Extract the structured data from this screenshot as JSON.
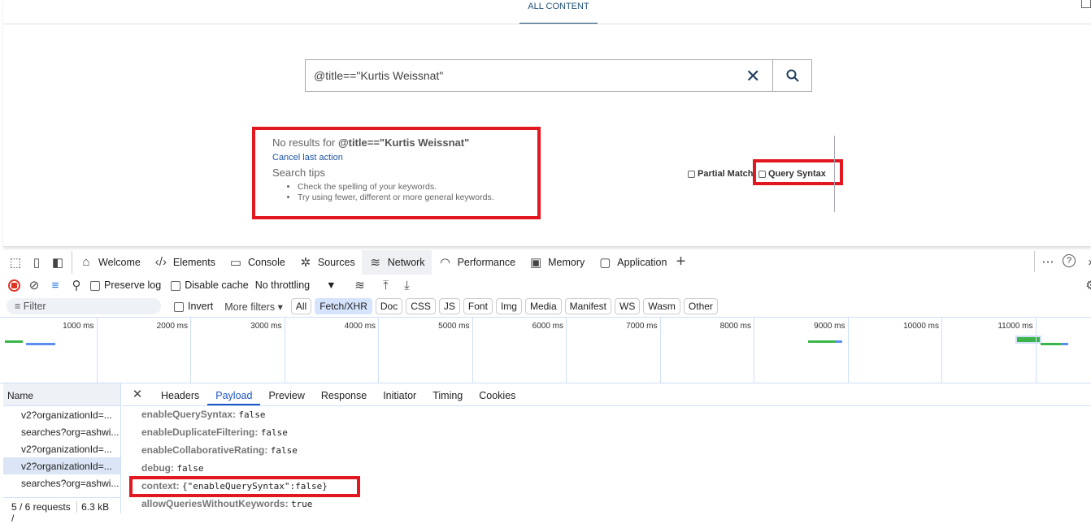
{
  "page": {
    "top_tab": "ALL CONTENT",
    "search_value": "@title==\"Kurtis Weissnat\"",
    "no_results_prefix": "No results for",
    "no_results_query": "@title==\"Kurtis Weissnat\"",
    "cancel_link": "Cancel last action",
    "tips_title": "Search tips",
    "tips": [
      "Check the spelling of your keywords.",
      "Try using fewer, different or more general keywords."
    ],
    "partial_match": "Partial Match",
    "query_syntax": "Query Syntax",
    "highlight_color": "#e3171f"
  },
  "devtools": {
    "tabs": [
      {
        "label": "Welcome",
        "icon": "home-icon"
      },
      {
        "label": "Elements",
        "icon": "code-icon"
      },
      {
        "label": "Console",
        "icon": "console-icon"
      },
      {
        "label": "Sources",
        "icon": "bug-icon"
      },
      {
        "label": "Network",
        "icon": "wifi-icon",
        "active": true
      },
      {
        "label": "Performance",
        "icon": "gauge-icon"
      },
      {
        "label": "Memory",
        "icon": "chip-icon"
      },
      {
        "label": "Application",
        "icon": "window-icon"
      }
    ],
    "toolbar": {
      "preserve_log": "Preserve log",
      "disable_cache": "Disable cache",
      "throttling": "No throttling"
    },
    "filter": {
      "placeholder": "Filter",
      "invert": "Invert",
      "more_filters": "More filters",
      "types": [
        "All",
        "Fetch/XHR",
        "Doc",
        "CSS",
        "JS",
        "Font",
        "Img",
        "Media",
        "Manifest",
        "WS",
        "Wasm",
        "Other"
      ],
      "active_type": "Fetch/XHR"
    },
    "timeline_ticks": [
      "1000 ms",
      "2000 ms",
      "3000 ms",
      "4000 ms",
      "5000 ms",
      "6000 ms",
      "7000 ms",
      "8000 ms",
      "9000 ms",
      "10000 ms",
      "11000 ms"
    ],
    "name_header": "Name",
    "requests": [
      "v2?organizationId=...",
      "searches?org=ashwi...",
      "v2?organizationId=...",
      "v2?organizationId=...",
      "searches?org=ashwi..."
    ],
    "selected_request": 3,
    "status": {
      "requests": "5 / 6 requests",
      "size": "6.3 kB /"
    },
    "detail_tabs": [
      "Headers",
      "Payload",
      "Preview",
      "Response",
      "Initiator",
      "Timing",
      "Cookies"
    ],
    "active_detail_tab": "Payload",
    "payload": [
      {
        "key": "enableQuerySyntax:",
        "value": "false"
      },
      {
        "key": "enableDuplicateFiltering:",
        "value": "false"
      },
      {
        "key": "enableCollaborativeRating:",
        "value": "false"
      },
      {
        "key": "debug:",
        "value": "false"
      },
      {
        "key": "context:",
        "value": "{\"enableQuerySyntax\":false}"
      },
      {
        "key": "allowQueriesWithoutKeywords:",
        "value": "true"
      }
    ]
  }
}
